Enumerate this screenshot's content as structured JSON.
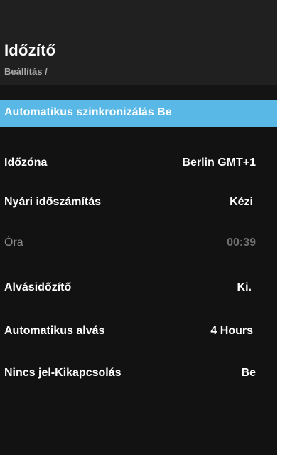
{
  "header": {
    "title": "Időzítő",
    "breadcrumb": "Beállítás /"
  },
  "menu": {
    "items": [
      {
        "label": "Automatikus szinkronizálás Be",
        "value": ""
      },
      {
        "label": "Időzóna",
        "value": "Berlin  GMT+1"
      },
      {
        "label": "Nyári időszámítás",
        "value": "Kézi"
      },
      {
        "label": "Óra",
        "value": "00:39"
      },
      {
        "label": "Alvásidőzítő",
        "value": "Ki."
      },
      {
        "label": "Automatikus alvás",
        "value": "4 Hours"
      },
      {
        "label": "Nincs jel-Kikapcsolás",
        "value": "Be"
      }
    ]
  },
  "colors": {
    "highlight": "#5ab8e6",
    "background": "#121212",
    "header_background": "#202020"
  }
}
